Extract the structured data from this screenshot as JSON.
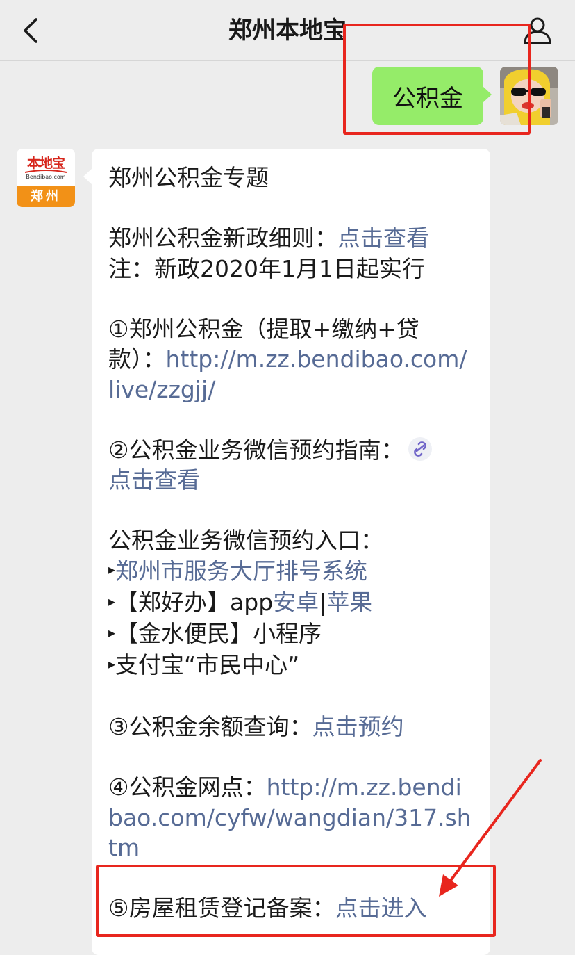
{
  "header": {
    "title": "郑州本地宝"
  },
  "user_message": {
    "text": "公积金"
  },
  "bot": {
    "avatar": {
      "logo_text": "本地宝",
      "logo_url": "Bendibao.com",
      "city": "郑州"
    },
    "message": {
      "title": "郑州公积金专题",
      "policy_label": "郑州公积金新政细则：",
      "policy_link": "点击查看",
      "note": "注：新政2020年1月1日起实行",
      "item1_label": "①郑州公积金（提取+缴纳+贷款）：",
      "item1_link": "http://m.zz.bendibao.com/live/zzgjj/",
      "item2_label": "②公积金业务微信预约指南：",
      "item2_link": "点击查看",
      "entry_title": "公积金业务微信预约入口：",
      "entry1_link": "郑州市服务大厅排号系统",
      "entry2_label": "【郑好办】app",
      "entry2_link_a": "安卓",
      "entry2_sep": "|",
      "entry2_link_b": "苹果",
      "entry3_label": "【金水便民】小程序",
      "entry4_label": "支付宝“市民中心”",
      "item3_label": "③公积金余额查询：",
      "item3_link": "点击预约",
      "item4_label": "④公积金网点：",
      "item4_link": "http://m.zz.bendibao.com/cyfw/wangdian/317.shtm",
      "item5_label": "⑤房屋租赁登记备案：",
      "item5_link": "点击进入"
    }
  },
  "colors": {
    "background": "#ededed",
    "user_bubble": "#95ec69",
    "link": "#576b95",
    "annotation": "#e8261e"
  },
  "icons": {
    "back": "chevron-left-icon",
    "profile": "user-icon",
    "mini_program": "link-icon"
  }
}
